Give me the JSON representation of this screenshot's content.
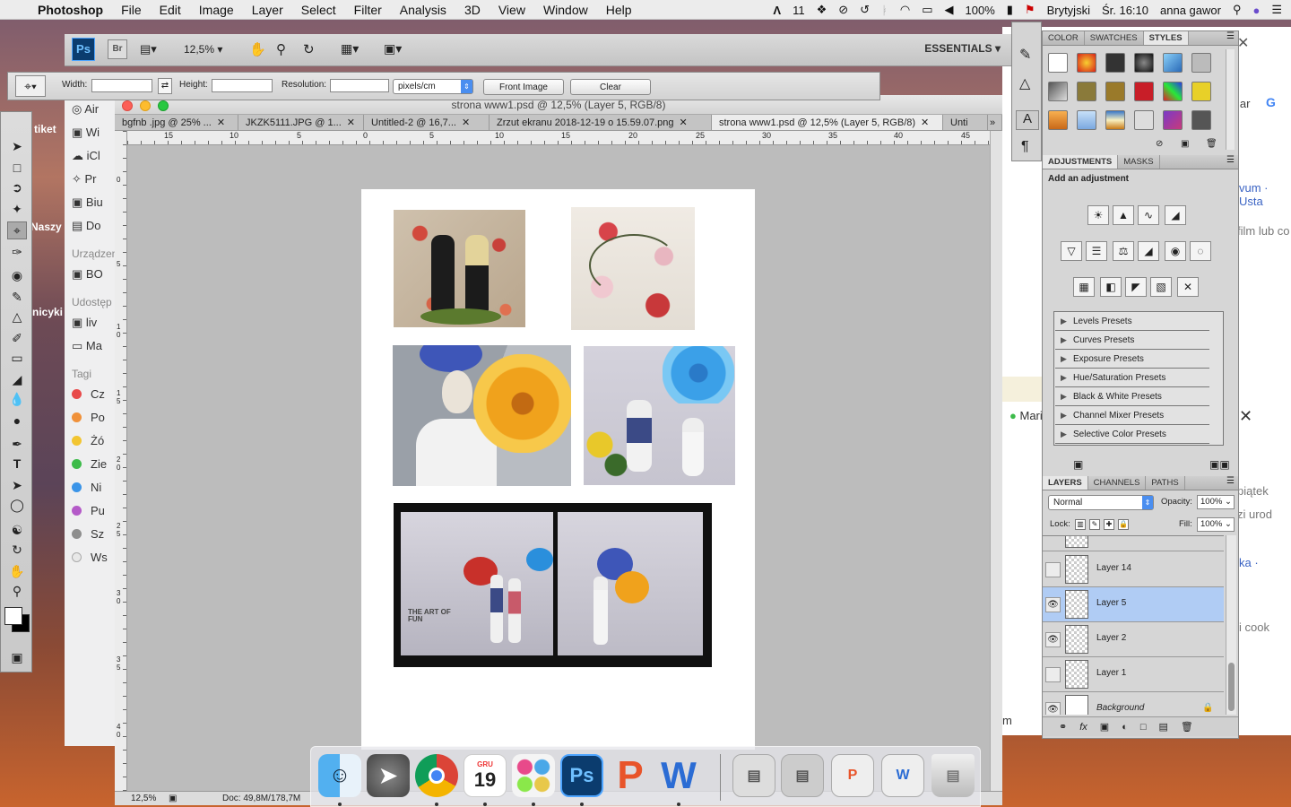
{
  "menubar": {
    "app_name": "Photoshop",
    "items": [
      "File",
      "Edit",
      "Image",
      "Layer",
      "Select",
      "Filter",
      "Analysis",
      "3D",
      "View",
      "Window",
      "Help"
    ],
    "status": {
      "adobe_count": "11",
      "battery": "100%",
      "keyboard": "Brytyjski",
      "clock": "Śr. 16:10",
      "user": "anna gawor"
    }
  },
  "appbar": {
    "zoom": "12,5%",
    "workspace": "ESSENTIALS"
  },
  "options": {
    "width_label": "Width:",
    "width_value": "",
    "height_label": "Height:",
    "height_value": "",
    "resolution_label": "Resolution:",
    "resolution_value": "",
    "unit": "pixels/cm",
    "front_image": "Front Image",
    "clear": "Clear"
  },
  "document": {
    "title": "strona www1.psd @ 12,5% (Layer 5, RGB/8)",
    "tabs": [
      {
        "label": "bgfnb .jpg @ 25% ...",
        "active": false
      },
      {
        "label": "JKZK5111.JPG @ 1...",
        "active": false
      },
      {
        "label": "Untitled-2 @ 16,7...",
        "active": false
      },
      {
        "label": "Zrzut ekranu 2018-12-19 o 15.59.07.png",
        "active": false
      },
      {
        "label": "strona www1.psd @ 12,5% (Layer 5, RGB/8)",
        "active": true
      },
      {
        "label": "Unti",
        "active": false
      }
    ],
    "ruler_h": [
      "15",
      "10",
      "5",
      "0",
      "5",
      "10",
      "15",
      "20",
      "25",
      "30",
      "35",
      "40",
      "45"
    ],
    "ruler_v": [
      "0",
      "5",
      "1",
      "0",
      "1",
      "5",
      "2",
      "0",
      "2",
      "5",
      "3",
      "0",
      "3",
      "5",
      "4",
      "0"
    ],
    "status_zoom": "12,5%",
    "status_doc": "Doc: 49,8M/178,7M",
    "photo_caption": "THE ART OF FUN"
  },
  "finder": {
    "items": [
      "Air",
      "Wi",
      "iCl",
      "Pr",
      "Biu",
      "Do"
    ],
    "devices_header": "Urządzen",
    "devices": [
      "BO"
    ],
    "shared_header": "Udostęp",
    "shared": [
      "liv",
      "Ma"
    ],
    "tags_header": "Tagi",
    "tags": [
      {
        "label": "Cz",
        "color": "#e84a4a"
      },
      {
        "label": "Po",
        "color": "#f0913a"
      },
      {
        "label": "Żó",
        "color": "#f2c531"
      },
      {
        "label": "Zie",
        "color": "#3dbb4a"
      },
      {
        "label": "Ni",
        "color": "#3a94e8"
      },
      {
        "label": "Pu",
        "color": "#b45ac8"
      },
      {
        "label": "Sz",
        "color": "#8e8e8e"
      },
      {
        "label": "Ws",
        "color": "#e8e8e8"
      }
    ]
  },
  "desktop_labels": {
    "a": "tiket",
    "b": "Naszy",
    "c": "nicyki"
  },
  "chrome_behind": {
    "lines": [
      "lar",
      "vum · Usta",
      "film lub co",
      "Mari",
      "piątek",
      "zi urod",
      "ka ·",
      "i cook",
      "m"
    ]
  },
  "panels": {
    "color_tabs": [
      "COLOR",
      "SWATCHES",
      "STYLES"
    ],
    "adjust_tabs": [
      "ADJUSTMENTS",
      "MASKS"
    ],
    "adjust_hint": "Add an adjustment",
    "presets": [
      "Levels Presets",
      "Curves Presets",
      "Exposure Presets",
      "Hue/Saturation Presets",
      "Black & White Presets",
      "Channel Mixer Presets",
      "Selective Color Presets"
    ],
    "layer_tabs": [
      "LAYERS",
      "CHANNELS",
      "PATHS"
    ],
    "blend_mode": "Normal",
    "opacity_label": "Opacity:",
    "opacity": "100%",
    "lock_label": "Lock:",
    "fill_label": "Fill:",
    "fill": "100%",
    "layers": [
      {
        "name": "Layer 14",
        "visible": false,
        "selected": false
      },
      {
        "name": "Layer 5",
        "visible": true,
        "selected": true
      },
      {
        "name": "Layer 2",
        "visible": true,
        "selected": false
      },
      {
        "name": "Layer 1",
        "visible": false,
        "selected": false
      },
      {
        "name": "Background",
        "visible": true,
        "selected": false
      }
    ]
  },
  "dock": {
    "calendar_month": "GRU",
    "calendar_day": "19"
  }
}
